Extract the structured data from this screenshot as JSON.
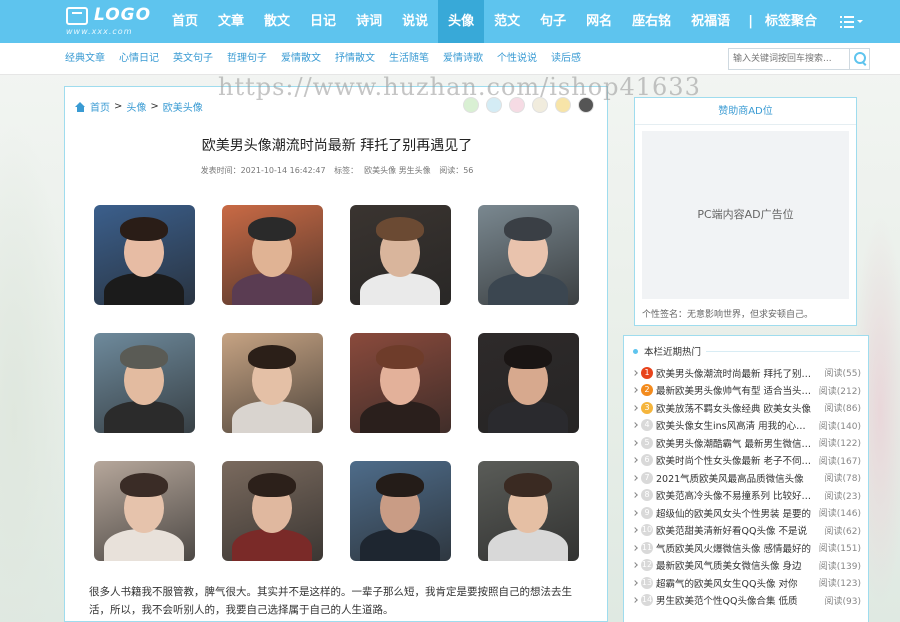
{
  "header": {
    "logo_text": "LOGO",
    "logo_sub": "www.xxx.com",
    "nav": [
      "首页",
      "文章",
      "散文",
      "日记",
      "诗词",
      "说说",
      "头像",
      "范文",
      "句子",
      "网名",
      "座右铭",
      "祝福语"
    ],
    "nav_active_index": 6,
    "nav_tags": "标签聚合",
    "accent_color": "#5ec4ee",
    "active_color": "#38a9d8"
  },
  "subnav": {
    "links": [
      "经典文章",
      "心情日记",
      "英文句子",
      "哲理句子",
      "爱情散文",
      "抒情散文",
      "生活随笔",
      "爱情诗歌",
      "个性说说",
      "读后感"
    ]
  },
  "search": {
    "placeholder": "输入关键词按回车搜索..."
  },
  "watermark": "https://www.huzhan.com/ishop41633",
  "breadcrumb": {
    "home": "首页",
    "level1": "头像",
    "level2": "欧美头像",
    "sep": ">"
  },
  "theme_colors": [
    "#d9f0d3",
    "#d4ecf5",
    "#f6dbe4",
    "#f1ecdd",
    "#f7e4a8",
    "#555555"
  ],
  "article": {
    "title": "欧美男头像潮流时尚最新 拜托了别再遇见了",
    "published": "发表时间：2021-10-14 16:42:47",
    "tags_label": "标签：",
    "tags": "欧美头像 男生头像",
    "reads": "阅读：56",
    "body": "很多人书籍我不服管教，脾气很大。其实并不是这样的。一辈子那么短，我肯定是要按照自己的想法去生活，所以，我不会听别人的，我要自己选择属于自己的人生道路。"
  },
  "ad": {
    "title": "赞助商AD位",
    "box_text": "PC端内容AD广告位",
    "signature": "个性签名：无意影响世界，但求安顿自己。"
  },
  "hot": {
    "heading": "本栏近期热门",
    "items": [
      {
        "num": "1",
        "title": "欧美男头像潮流时尚最新  拜托了别再遇见了",
        "reads": "阅读(55)"
      },
      {
        "num": "2",
        "title": "最新欧美男头像帅气有型  适合当头像的",
        "reads": "阅读(212)"
      },
      {
        "num": "3",
        "title": "欧美放荡不羁女头像经典  欧美女头像",
        "reads": "阅读(86)"
      },
      {
        "num": "4",
        "title": "欧美头像女生ins风高清  用我的心去爱你",
        "reads": "阅读(140)"
      },
      {
        "num": "5",
        "title": "欧美男头像潮酷霸气  最新男生微信头像",
        "reads": "阅读(122)"
      },
      {
        "num": "6",
        "title": "欧美时尚个性女头像最新  老子不伺候了",
        "reads": "阅读(167)"
      },
      {
        "num": "7",
        "title": "2021气质欧美风最高品质微信头像",
        "reads": "阅读(78)"
      },
      {
        "num": "8",
        "title": "欧美范高冷头像不易撞系列  比较好看的",
        "reads": "阅读(23)"
      },
      {
        "num": "9",
        "title": "超级仙的欧美风女头个性男装  是要的",
        "reads": "阅读(146)"
      },
      {
        "num": "10",
        "title": "欧美范甜美清新好看QQ头像  不是说",
        "reads": "阅读(62)"
      },
      {
        "num": "11",
        "title": "气质欧美风火爆微信头像  感情最好的",
        "reads": "阅读(151)"
      },
      {
        "num": "12",
        "title": "最新欧美风气质美女微信头像  身边",
        "reads": "阅读(139)"
      },
      {
        "num": "13",
        "title": "超霸气的欧美风女生QQ头像  对你",
        "reads": "阅读(123)"
      },
      {
        "num": "14",
        "title": "男生欧美范个性QQ头像合集  低质",
        "reads": "阅读(93)"
      }
    ]
  },
  "photos": [
    {
      "bg": "#3b5f8c",
      "skin": "#e7bca4",
      "hair": "#2a1d17",
      "shirt": "#1b1b1b"
    },
    {
      "bg": "#c96a45",
      "skin": "#e0b394",
      "hair": "#2a2a2a",
      "shirt": "#5a3c52"
    },
    {
      "bg": "#3a3430",
      "skin": "#d9b59c",
      "hair": "#6b4a33",
      "shirt": "#eaeaea"
    },
    {
      "bg": "#7a8890",
      "skin": "#e9c3ad",
      "hair": "#3a3f45",
      "shirt": "#3b4650"
    },
    {
      "bg": "#6e8a9c",
      "skin": "#e3bba0",
      "hair": "#5a5b55",
      "shirt": "#2b2b2b"
    },
    {
      "bg": "#c6a383",
      "skin": "#e4c0a6",
      "hair": "#2b1f18",
      "shirt": "#d9d4cf"
    },
    {
      "bg": "#8a4a3c",
      "skin": "#e3b19a",
      "hair": "#6e3c2a",
      "shirt": "#2a1f1c"
    },
    {
      "bg": "#2e2a2a",
      "skin": "#d7a98e",
      "hair": "#1a1514",
      "shirt": "#2a2a2e"
    },
    {
      "bg": "#b6a79b",
      "skin": "#e6c3ac",
      "hair": "#3a2c26",
      "shirt": "#e8e1da"
    },
    {
      "bg": "#7a6a5e",
      "skin": "#e0b89f",
      "hair": "#2c201a",
      "shirt": "#7a2a28"
    },
    {
      "bg": "#4e6c8a",
      "skin": "#c99c85",
      "hair": "#241c18",
      "shirt": "#1e2630"
    },
    {
      "bg": "#5a5c58",
      "skin": "#e5bfa4",
      "hair": "#3a2a22",
      "shirt": "#d8d8d8"
    }
  ]
}
